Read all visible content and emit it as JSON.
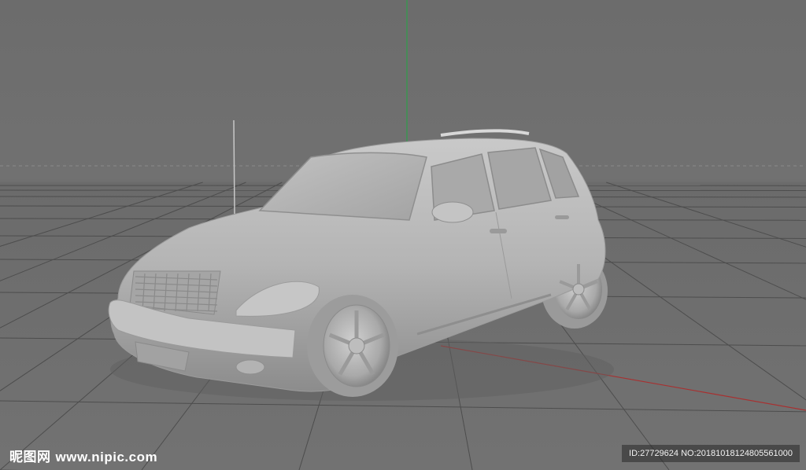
{
  "viewport": {
    "background": "#6f6f6f",
    "grid_color": "#4a4a4a",
    "axis_y_color": "#2f9e4a",
    "axis_x_color": "#b02b2b",
    "car_color": "#b9b9b9"
  },
  "watermark": {
    "brand": "昵图网",
    "url": "www.nipic.com",
    "id_text": "ID:27729624 NO:20181018124805561000"
  }
}
